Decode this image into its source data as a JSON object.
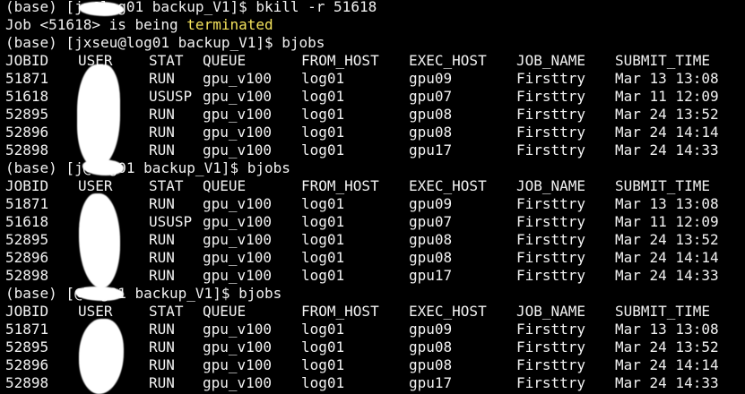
{
  "colors": {
    "background": "#000000",
    "text": "#f2f2f2",
    "highlight": "#f3e25c"
  },
  "session": {
    "lines": [
      {
        "type": "text",
        "segments": [
          {
            "text": "(base) [jx",
            "style": "normal"
          },
          {
            "text": "@log01 backup_V1]$ bkill -r 51618",
            "style": "normal"
          }
        ]
      },
      {
        "type": "text",
        "segments": [
          {
            "text": "Job <51618> is being ",
            "style": "normal"
          },
          {
            "text": "terminated",
            "style": "highlight"
          }
        ]
      },
      {
        "type": "text",
        "segments": [
          {
            "text": "(base) [jxseu@log01 backup_V1]$ bjobs",
            "style": "normal"
          }
        ]
      },
      {
        "type": "row",
        "cells": [
          "JOBID",
          "USER",
          "STAT",
          "QUEUE",
          "FROM_HOST",
          "EXEC_HOST",
          "JOB_NAME",
          "SUBMIT_TIME"
        ]
      },
      {
        "type": "row",
        "cells": [
          "51871",
          "",
          "RUN",
          "gpu_v100",
          "log01",
          "gpu09",
          "Firsttry",
          "Mar 13 13:08"
        ]
      },
      {
        "type": "row",
        "cells": [
          "51618",
          "",
          "USUSP",
          "gpu_v100",
          "log01",
          "gpu07",
          "Firsttry",
          "Mar 11 12:09"
        ]
      },
      {
        "type": "row",
        "cells": [
          "52895",
          "",
          "RUN",
          "gpu_v100",
          "log01",
          "gpu08",
          "Firsttry",
          "Mar 24 13:52"
        ]
      },
      {
        "type": "row",
        "cells": [
          "52896",
          "",
          "RUN",
          "gpu_v100",
          "log01",
          "gpu08",
          "Firsttry",
          "Mar 24 14:14"
        ]
      },
      {
        "type": "row",
        "cells": [
          "52898",
          "",
          "RUN",
          "gpu_v100",
          "log01",
          "gpu17",
          "Firsttry",
          "Mar 24 14:33"
        ]
      },
      {
        "type": "text",
        "segments": [
          {
            "text": "(base) [j",
            "style": "normal"
          },
          {
            "text": "@log01 backup_V1]$ bjobs",
            "style": "normal"
          }
        ]
      },
      {
        "type": "row",
        "cells": [
          "JOBID",
          "USER",
          "STAT",
          "QUEUE",
          "FROM_HOST",
          "EXEC_HOST",
          "JOB_NAME",
          "SUBMIT_TIME"
        ]
      },
      {
        "type": "row",
        "cells": [
          "51871",
          "",
          "RUN",
          "gpu_v100",
          "log01",
          "gpu09",
          "Firsttry",
          "Mar 13 13:08"
        ]
      },
      {
        "type": "row",
        "cells": [
          "51618",
          "",
          "USUSP",
          "gpu_v100",
          "log01",
          "gpu07",
          "Firsttry",
          "Mar 11 12:09"
        ]
      },
      {
        "type": "row",
        "cells": [
          "52895",
          "",
          "RUN",
          "gpu_v100",
          "log01",
          "gpu08",
          "Firsttry",
          "Mar 24 13:52"
        ]
      },
      {
        "type": "row",
        "cells": [
          "52896",
          "",
          "RUN",
          "gpu_v100",
          "log01",
          "gpu08",
          "Firsttry",
          "Mar 24 14:14"
        ]
      },
      {
        "type": "row",
        "cells": [
          "52898",
          "",
          "RUN",
          "gpu_v100",
          "log01",
          "gpu17",
          "Firsttry",
          "Mar 24 14:33"
        ]
      },
      {
        "type": "text",
        "segments": [
          {
            "text": "(base) [",
            "style": "normal"
          },
          {
            "text": "@log01 backup_V1]$ bjobs",
            "style": "normal"
          }
        ]
      },
      {
        "type": "row",
        "cells": [
          "JOBID",
          "USER",
          "STAT",
          "QUEUE",
          "FROM_HOST",
          "EXEC_HOST",
          "JOB_NAME",
          "SUBMIT_TIME"
        ]
      },
      {
        "type": "row",
        "cells": [
          "51871",
          "",
          "RUN",
          "gpu_v100",
          "log01",
          "gpu09",
          "Firsttry",
          "Mar 13 13:08"
        ]
      },
      {
        "type": "row",
        "cells": [
          "52895",
          "",
          "RUN",
          "gpu_v100",
          "log01",
          "gpu08",
          "Firsttry",
          "Mar 24 13:52"
        ]
      },
      {
        "type": "row",
        "cells": [
          "52896",
          "",
          "RUN",
          "gpu_v100",
          "log01",
          "gpu08",
          "Firsttry",
          "Mar 24 14:14"
        ]
      },
      {
        "type": "row",
        "cells": [
          "52898",
          "",
          "RUN",
          "gpu_v100",
          "log01",
          "gpu17",
          "Firsttry",
          "Mar 24 14:33"
        ]
      }
    ]
  }
}
